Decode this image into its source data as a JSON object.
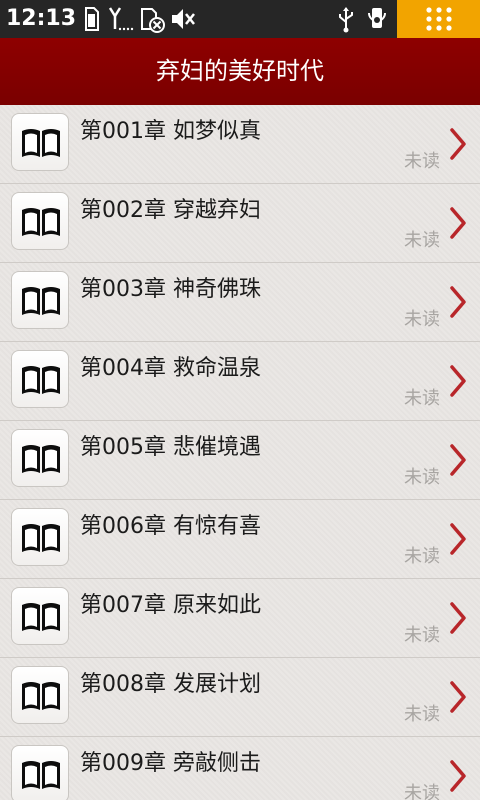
{
  "status_bar": {
    "time": "12:13",
    "icons": [
      "sd-card-icon",
      "signal-icon",
      "no-sim-icon",
      "mute-icon",
      "usb-icon",
      "usb-debug-icon",
      "launcher-grid-icon"
    ]
  },
  "header": {
    "title": "弃妇的美好时代"
  },
  "chapters": [
    {
      "title": "第001章 如梦似真",
      "status": "未读"
    },
    {
      "title": "第002章 穿越弃妇",
      "status": "未读"
    },
    {
      "title": "第003章 神奇佛珠",
      "status": "未读"
    },
    {
      "title": "第004章 救命温泉",
      "status": "未读"
    },
    {
      "title": "第005章 悲催境遇",
      "status": "未读"
    },
    {
      "title": "第006章 有惊有喜",
      "status": "未读"
    },
    {
      "title": "第007章 原来如此",
      "status": "未读"
    },
    {
      "title": "第008章 发展计划",
      "status": "未读"
    },
    {
      "title": "第009章 旁敲侧击",
      "status": "未读"
    }
  ],
  "colors": {
    "header_bg": "#8e0000",
    "launcher_bg": "#f2a400",
    "chevron": "#b8262a"
  }
}
